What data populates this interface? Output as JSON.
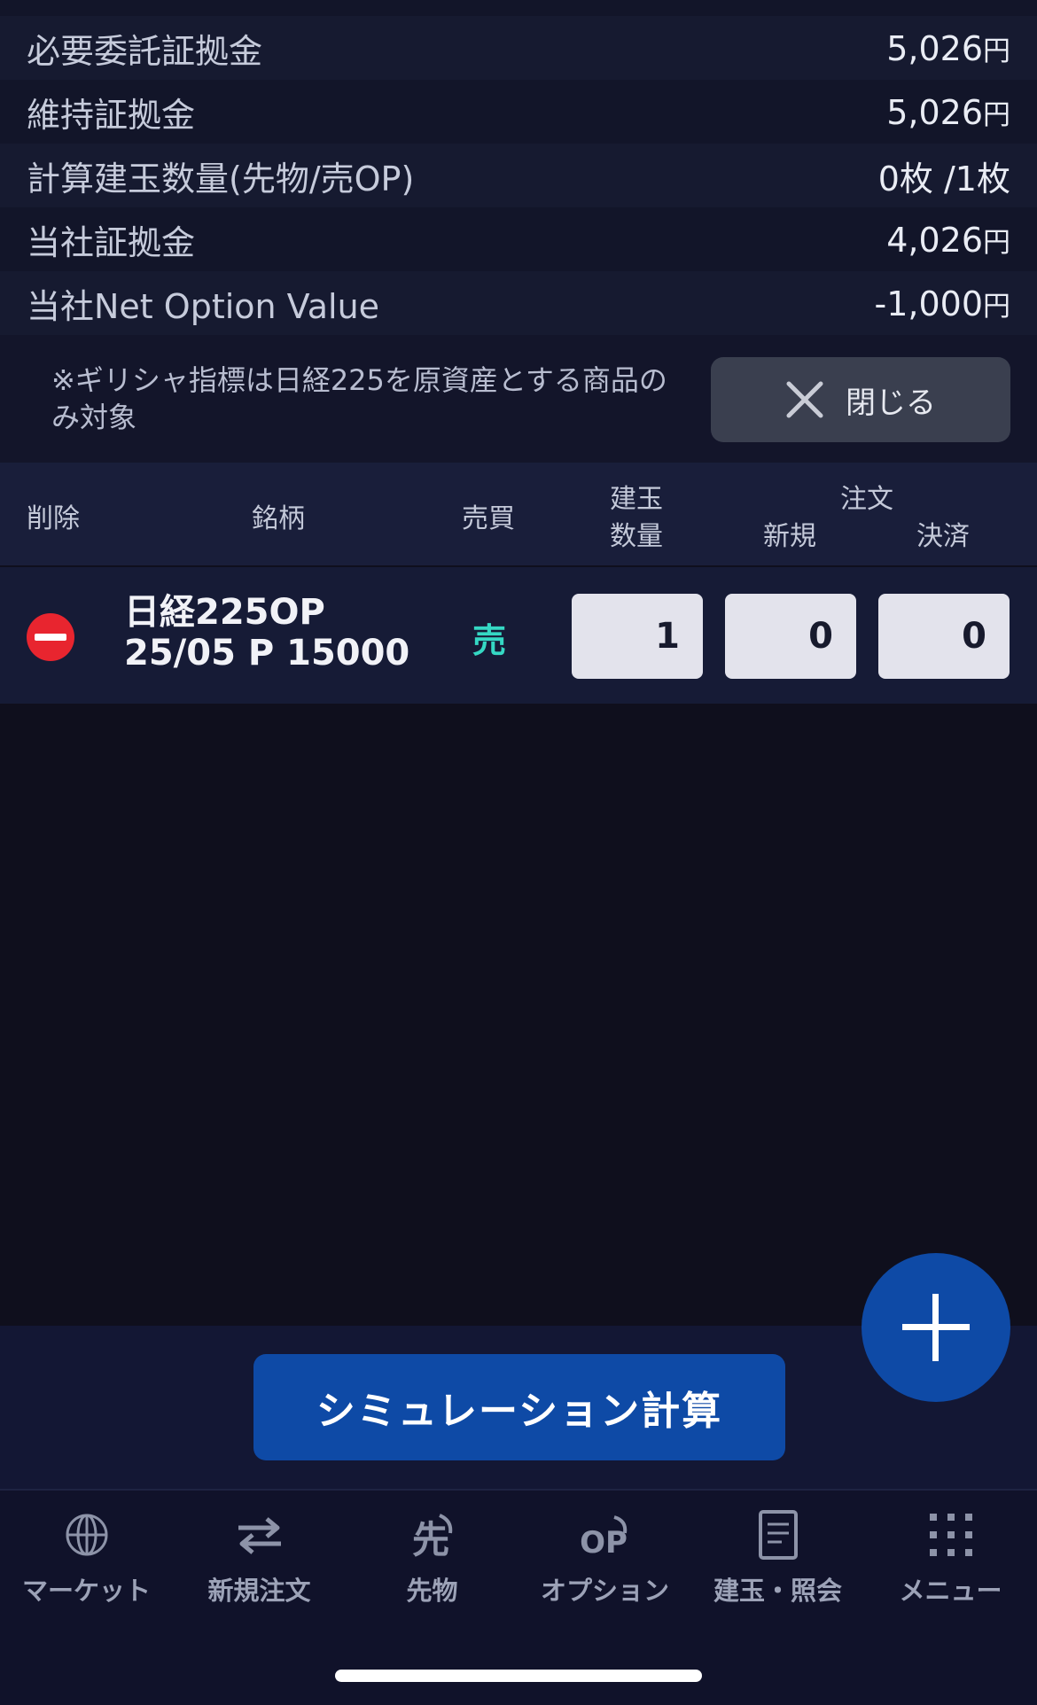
{
  "summary": [
    {
      "label": "必要委託証拠金",
      "value": "5,026",
      "unit": "円"
    },
    {
      "label": "維持証拠金",
      "value": "5,026",
      "unit": "円"
    },
    {
      "label": "計算建玉数量(先物/売OP)",
      "value": "0枚 /1枚",
      "unit": ""
    },
    {
      "label": "当社証拠金",
      "value": "4,026",
      "unit": "円"
    },
    {
      "label": "当社Net Option Value",
      "value": "-1,000",
      "unit": "円"
    }
  ],
  "note": {
    "text": "※ギリシャ指標は日経225を原資産とする商品のみ対象",
    "close_label": "閉じる"
  },
  "table": {
    "headers": {
      "delete": "削除",
      "symbol": "銘柄",
      "side": "売買",
      "position_line1": "建玉",
      "position_line2": "数量",
      "order": "注文",
      "new": "新規",
      "settle": "決済"
    },
    "rows": [
      {
        "symbol_line1": "日経225OP",
        "symbol_line2": "25/05 P 15000",
        "side": "売",
        "position_qty": "1",
        "new_qty": "0",
        "settle_qty": "0"
      }
    ]
  },
  "simulate_label": "シミュレーション計算",
  "tabs": [
    {
      "label": "マーケット",
      "icon": "globe-icon"
    },
    {
      "label": "新規注文",
      "icon": "swap-arrows-icon"
    },
    {
      "label": "先物",
      "icon": "futures-icon"
    },
    {
      "label": "オプション",
      "icon": "option-icon"
    },
    {
      "label": "建玉・照会",
      "icon": "document-icon"
    },
    {
      "label": "メニュー",
      "icon": "grid-menu-icon"
    }
  ],
  "colors": {
    "background": "#0f0f1d",
    "accent": "#0e4aa6",
    "sell": "#35d8c4",
    "delete": "#e8252f"
  }
}
